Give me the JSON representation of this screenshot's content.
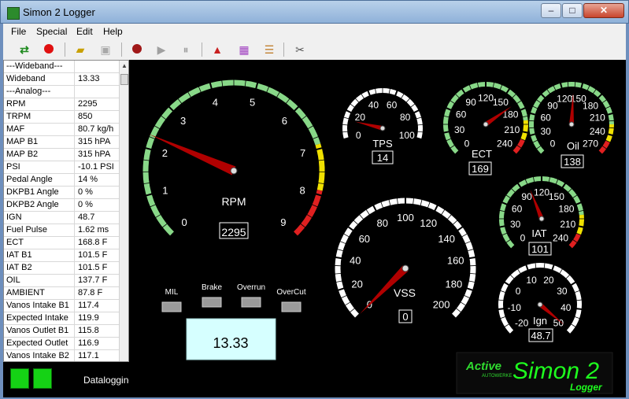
{
  "window": {
    "title": "Simon 2 Logger",
    "minimize": "–",
    "maximize": "□",
    "close": "✕"
  },
  "menu": [
    "File",
    "Special",
    "Edit",
    "Help"
  ],
  "toolbar": {
    "icons": [
      "connect-arrows-icon",
      "stop-record-icon",
      "open-folder-icon",
      "save-disk-icon",
      "record-icon",
      "play-icon",
      "pause-icon",
      "warning-icon",
      "chart-icon",
      "table-icon",
      "tools-icon"
    ]
  },
  "sensors": [
    {
      "name": "---Wideband---",
      "value": ""
    },
    {
      "name": "Wideband",
      "value": "13.33"
    },
    {
      "name": "---Analog---",
      "value": ""
    },
    {
      "name": "RPM",
      "value": "2295"
    },
    {
      "name": "TRPM",
      "value": "850"
    },
    {
      "name": "MAF",
      "value": "80.7 kg/h"
    },
    {
      "name": "MAP B1",
      "value": "315 hPA"
    },
    {
      "name": "MAP B2",
      "value": "315 hPA"
    },
    {
      "name": "PSI",
      "value": "-10.1 PSI"
    },
    {
      "name": "Pedal Angle",
      "value": "14 %"
    },
    {
      "name": "DKPB1 Angle",
      "value": "0 %"
    },
    {
      "name": "DKPB2 Angle",
      "value": "0 %"
    },
    {
      "name": "IGN",
      "value": "48.7"
    },
    {
      "name": "Fuel Pulse",
      "value": "1.62 ms"
    },
    {
      "name": "ECT",
      "value": "168.8 F"
    },
    {
      "name": "IAT B1",
      "value": "101.5 F"
    },
    {
      "name": "IAT B2",
      "value": "101.5 F"
    },
    {
      "name": "OIL",
      "value": "137.7 F"
    },
    {
      "name": "AMBIENT",
      "value": "87.8 F"
    },
    {
      "name": "Vanos Intake B1",
      "value": "117.4"
    },
    {
      "name": "Expected Intake",
      "value": "119.9"
    },
    {
      "name": "Vanos Outlet B1",
      "value": "115.8"
    },
    {
      "name": "Expected Outlet",
      "value": "116.9"
    },
    {
      "name": "Vanos Intake B2",
      "value": "117.1"
    }
  ],
  "status": {
    "label": "Datalogging",
    "led_color": "#15d215"
  },
  "gauges": {
    "rpm": {
      "label": "RPM",
      "value": 2295,
      "value_text": "2295",
      "ticks": [
        "0",
        "1",
        "2",
        "3",
        "4",
        "5",
        "6",
        "7",
        "8",
        "9"
      ],
      "min": 0,
      "max": 9000
    },
    "tps": {
      "label": "TPS",
      "value": 14,
      "value_text": "14",
      "ticks": [
        "0",
        "20",
        "40",
        "60",
        "80",
        "100"
      ],
      "min": 0,
      "max": 100
    },
    "ect": {
      "label": "ECT",
      "value": 169,
      "value_text": "169",
      "ticks": [
        "0",
        "30",
        "60",
        "90",
        "120",
        "150",
        "180",
        "210",
        "240"
      ],
      "min": 0,
      "max": 240
    },
    "oil": {
      "label": "Oil",
      "value": 138,
      "value_text": "138",
      "ticks": [
        "0",
        "30",
        "60",
        "90",
        "120",
        "150",
        "180",
        "210",
        "240",
        "270"
      ],
      "min": 0,
      "max": 270
    },
    "iat": {
      "label": "IAT",
      "value": 101,
      "value_text": "101",
      "ticks": [
        "0",
        "30",
        "60",
        "90",
        "120",
        "150",
        "180",
        "210",
        "240"
      ],
      "min": 0,
      "max": 240
    },
    "vss": {
      "label": "VSS",
      "value": 0,
      "value_text": "0",
      "ticks": [
        "0",
        "20",
        "40",
        "60",
        "80",
        "100",
        "120",
        "140",
        "160",
        "180",
        "200"
      ],
      "min": 0,
      "max": 200
    },
    "ign": {
      "label": "Ign",
      "value": 48.7,
      "value_text": "48.7",
      "ticks": [
        "-20",
        "-10",
        "0",
        "10",
        "20",
        "30",
        "40",
        "50"
      ],
      "min": -20,
      "max": 50
    }
  },
  "indicators": [
    "MIL",
    "Brake",
    "Overrun",
    "OverCut"
  ],
  "wideband_display": "13.33",
  "logo": {
    "brand": "Active",
    "sub": "AUTOWERKE",
    "product": "Simon 2",
    "tag": "Logger"
  }
}
